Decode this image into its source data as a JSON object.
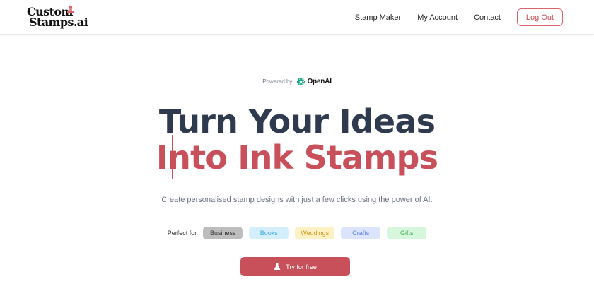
{
  "logo": {
    "line1": "Custom",
    "line2": "Stamps.ai"
  },
  "nav": {
    "links": [
      "Stamp Maker",
      "My Account",
      "Contact"
    ],
    "logout_label": "Log Out"
  },
  "powered": {
    "label": "Powered by",
    "brand": "OpenAI"
  },
  "hero": {
    "line1": "Turn Your Ideas",
    "line2": "Into Ink Stamps",
    "subtitle": "Create personalised stamp designs with just a few clicks using the power of AI."
  },
  "perfect_for": {
    "label": "Perfect for",
    "tags": [
      {
        "label": "Business",
        "bg": "#bdbdbd",
        "color": "#333333"
      },
      {
        "label": "Books",
        "bg": "#d4effb",
        "color": "#3fa9dc"
      },
      {
        "label": "Weddings",
        "bg": "#fdf1c4",
        "color": "#d19a1e"
      },
      {
        "label": "Crafts",
        "bg": "#dbe4fb",
        "color": "#5b7fe0"
      },
      {
        "label": "Gifts",
        "bg": "#d6f7db",
        "color": "#3fae57"
      }
    ]
  },
  "cta": {
    "label": "Try for free"
  },
  "colors": {
    "accent": "#c8505a",
    "heading": "#2f3a4e"
  },
  "icons": {
    "logo_mark": "stamp-icon",
    "brand_mark": "openai-icon",
    "cta_icon": "flask-icon"
  }
}
